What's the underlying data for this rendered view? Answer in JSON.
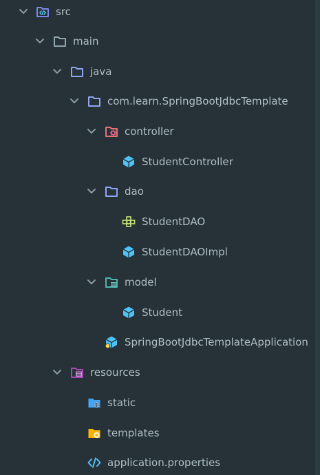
{
  "tree": {
    "src": "src",
    "main": "main",
    "java": "java",
    "package": "com.learn.SpringBootJdbcTemplate",
    "controller": "controller",
    "student_controller": "StudentController",
    "dao": "dao",
    "student_dao": "StudentDAO",
    "student_dao_impl": "StudentDAOImpl",
    "model": "model",
    "student": "Student",
    "application": "SpringBootJdbcTemplateApplication",
    "resources": "resources",
    "static": "static",
    "templates": "templates",
    "properties": "application.properties"
  },
  "colors": {
    "background": "#263238",
    "text": "#b0bec5",
    "chevron": "#8a9ba3",
    "folder": "#90a4f4",
    "folder_src": "#7b86e8",
    "code_accent": "#4fc3f7",
    "controller_folder": "#e57373",
    "model_folder": "#4db6ac",
    "class_icon": "#4fc3f7",
    "interface_icon": "#c5e478",
    "resources_folder": "#ab47bc",
    "static_folder": "#42a5f5",
    "templates_folder": "#ffb300",
    "properties_icon": "#4fc3f7"
  },
  "icons": {
    "chevron": "chevron-down-icon",
    "folder": "folder-icon",
    "source_folder": "source-folder-icon",
    "controller_folder": "controller-folder-icon",
    "model_folder": "model-folder-icon",
    "class": "class-icon",
    "interface": "interface-icon",
    "spring_boot_app": "spring-boot-class-icon",
    "resources_folder": "resources-folder-icon",
    "static_folder": "static-folder-icon",
    "templates_folder": "templates-folder-icon",
    "properties_file": "code-file-icon"
  }
}
